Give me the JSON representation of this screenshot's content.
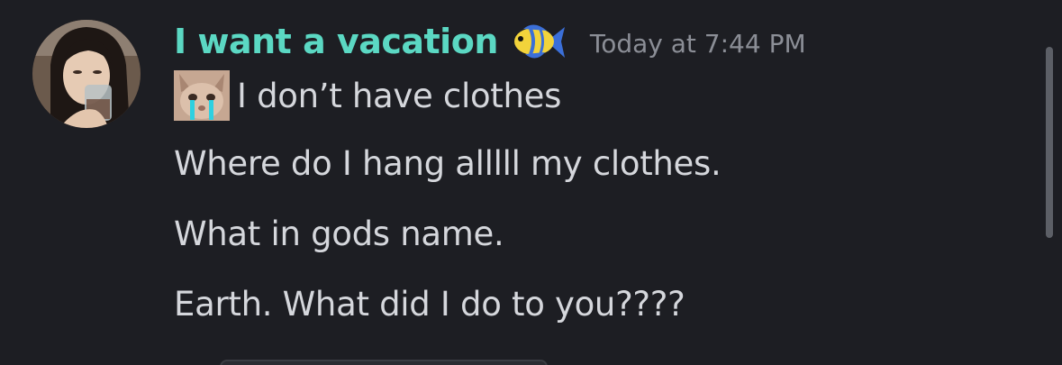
{
  "message": {
    "username": "I want a vacation",
    "username_color": "#5bd8c3",
    "username_emoji": "tropical-fish-icon",
    "timestamp": "Today at 7:44 PM",
    "avatar": "user-avatar-photo",
    "lines": [
      {
        "emoji": "crying-cat-icon",
        "text": "I don’t have clothes"
      },
      {
        "text": "Where do I hang alllll my clothes."
      },
      {
        "text": "What in gods name."
      },
      {
        "text": "Earth. What did I do to you????"
      }
    ]
  },
  "colors": {
    "background": "#1d1e23",
    "text": "#d5d7dc",
    "timestamp": "#8b8e96"
  }
}
